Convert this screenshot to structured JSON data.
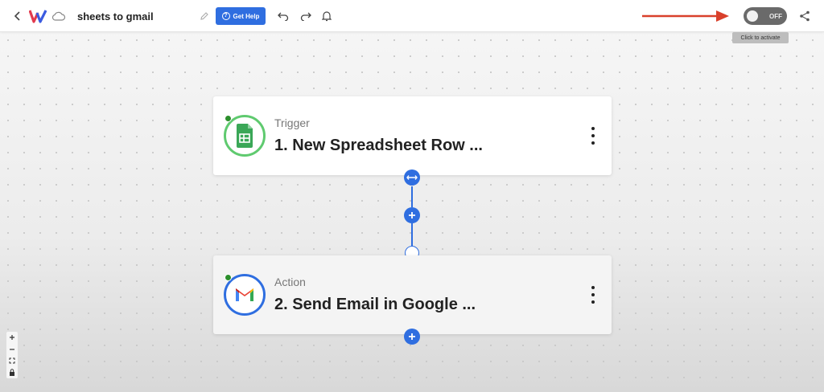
{
  "header": {
    "title": "sheets to gmail",
    "help_label": "Get Help",
    "toggle_state": "OFF",
    "toggle_tooltip": "Click to activate"
  },
  "steps": [
    {
      "kind": "Trigger",
      "name": "1. New Spreadsheet Row ...",
      "app_icon": "google-sheets-icon",
      "accent": "#5fca6f"
    },
    {
      "kind": "Action",
      "name": "2. Send Email in Google ...",
      "app_icon": "gmail-icon",
      "accent": "#2f6ee0"
    }
  ],
  "colors": {
    "primary": "#2f6ee0",
    "arrow": "#d9402b",
    "status_dot": "#2c8f2c"
  },
  "canvas_controls": [
    "zoom-in-icon",
    "zoom-out-icon",
    "fit-view-icon",
    "lock-icon"
  ]
}
